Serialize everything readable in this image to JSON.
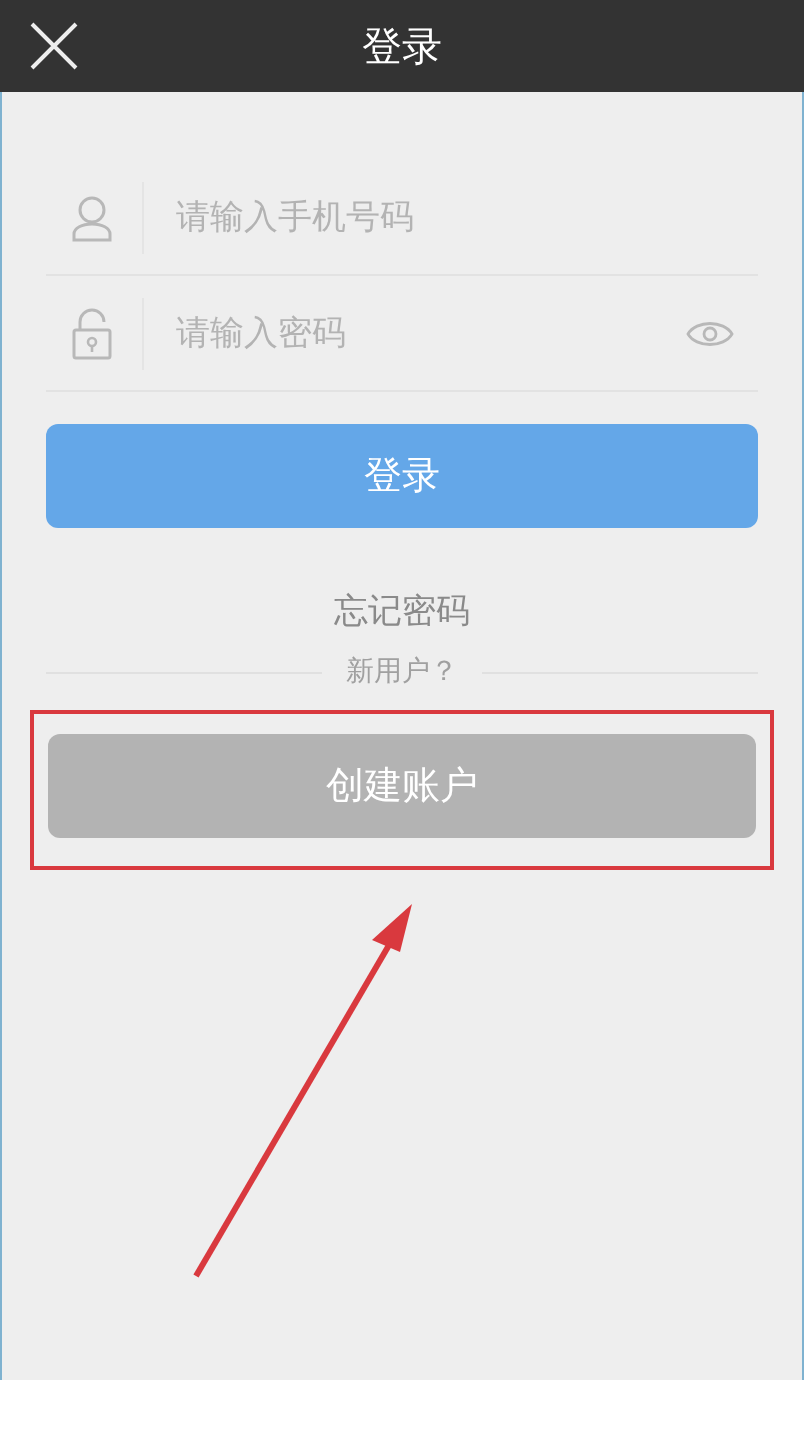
{
  "header": {
    "title": "登录"
  },
  "fields": [
    {
      "kind": "phone",
      "placeholder": "请输入手机号码"
    },
    {
      "kind": "password",
      "placeholder": "请输入密码"
    }
  ],
  "login_button": "登录",
  "forgot_link": "忘记密码",
  "new_user_label": "新用户？",
  "create_button": {
    "label": "创建账户",
    "highlighted": true
  }
}
